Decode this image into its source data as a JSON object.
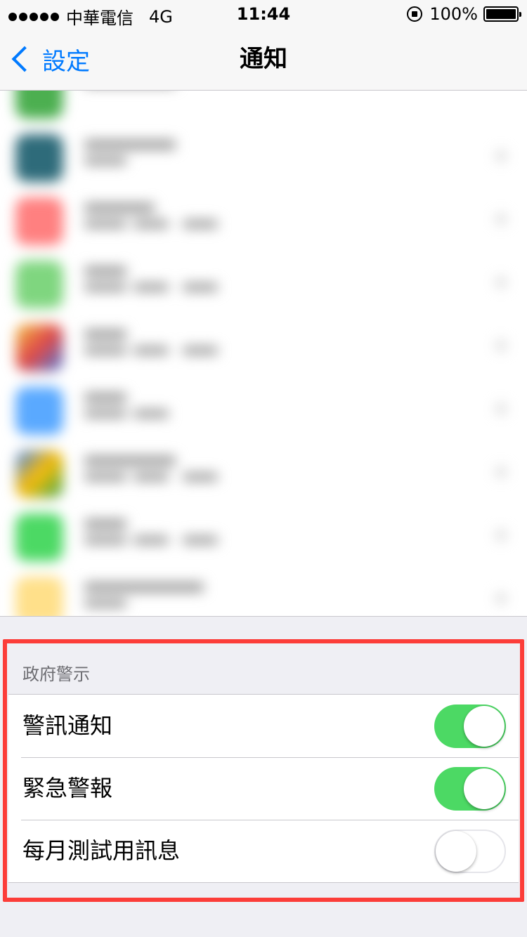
{
  "status_bar": {
    "carrier": "中華電信",
    "network": "4G",
    "time": "11:44",
    "battery": "100%"
  },
  "nav": {
    "back_label": "設定",
    "title": "通知"
  },
  "government_alerts": {
    "header": "政府警示",
    "rows": [
      {
        "label": "警訊通知",
        "enabled": true
      },
      {
        "label": "緊急警報",
        "enabled": true
      },
      {
        "label": "每月測試用訊息",
        "enabled": false
      }
    ]
  },
  "colors": {
    "accent": "#007aff",
    "toggle_on": "#4cd964",
    "highlight": "#fc3d39"
  }
}
